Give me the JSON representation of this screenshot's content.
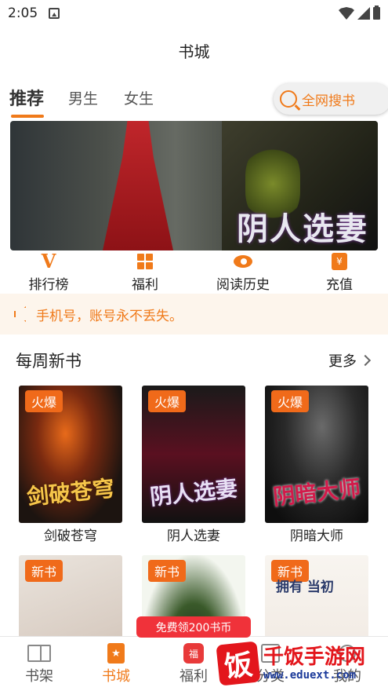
{
  "status": {
    "time": "2:05"
  },
  "header": {
    "title": "书城"
  },
  "tabs": [
    {
      "label": "推荐",
      "active": true
    },
    {
      "label": "男生",
      "active": false
    },
    {
      "label": "女生",
      "active": false
    }
  ],
  "search": {
    "label": "全网搜书"
  },
  "banner": {
    "title": "阴人选妻"
  },
  "quick_nav": [
    {
      "label": "排行榜",
      "icon": "rank-v-icon"
    },
    {
      "label": "福利",
      "icon": "grid-icon"
    },
    {
      "label": "阅读历史",
      "icon": "eye-icon"
    },
    {
      "label": "充值",
      "icon": "recharge-icon",
      "glyph": "¥"
    }
  ],
  "notice": {
    "text": "手机号，账号永不丢失。"
  },
  "weekly": {
    "title": "每周新书",
    "more_label": "更多",
    "books": [
      {
        "name": "剑破苍穹",
        "badge": "火爆",
        "cover_text": "剑破苍穹"
      },
      {
        "name": "阴人选妻",
        "badge": "火爆",
        "cover_text": "阴人选妻"
      },
      {
        "name": "阴暗大师",
        "badge": "火爆",
        "cover_text": "阴暗大师"
      },
      {
        "badge": "新书"
      },
      {
        "badge": "新书"
      },
      {
        "badge": "新书",
        "cover_text": "拥有 当初"
      }
    ]
  },
  "promo": {
    "text": "免费领200书币"
  },
  "bottom_nav": [
    {
      "label": "书架",
      "active": false
    },
    {
      "label": "书城",
      "active": true
    },
    {
      "label": "福利",
      "active": false
    },
    {
      "label": "分类",
      "active": false
    },
    {
      "label": "我的",
      "active": false
    }
  ],
  "watermark": {
    "logo": "饭",
    "name": "千饭手游网",
    "url": "www.eduext.com"
  },
  "colors": {
    "accent": "#f07a1a",
    "promo": "#f0323a",
    "watermark_red": "#e3161c",
    "watermark_blue": "#1b3a9a"
  }
}
